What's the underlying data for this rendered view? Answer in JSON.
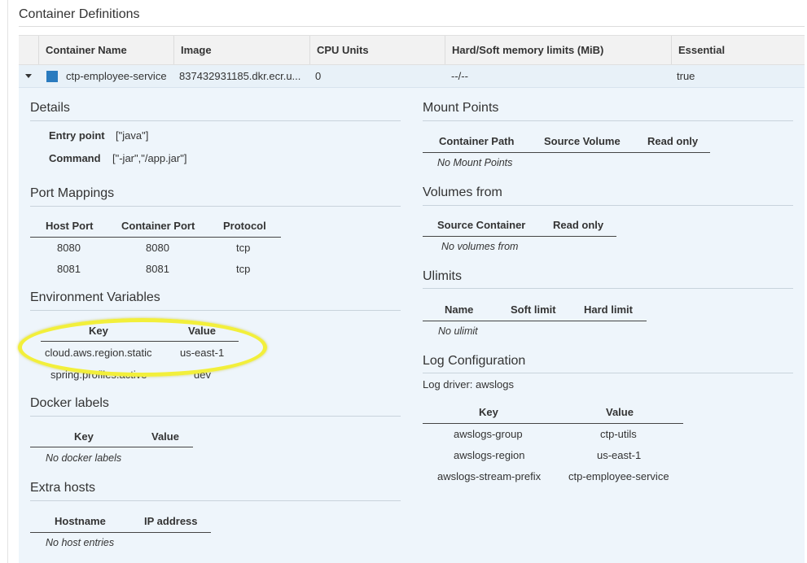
{
  "section_title": "Container Definitions",
  "table": {
    "headers": [
      "Container Name",
      "Image",
      "CPU Units",
      "Hard/Soft memory limits (MiB)",
      "Essential"
    ],
    "row": {
      "name": "ctp-employee-service",
      "image": "837432931185.dkr.ecr.u...",
      "cpu": "0",
      "memory": "--/--",
      "essential": "true"
    }
  },
  "details": {
    "title": "Details",
    "entry_point_label": "Entry point",
    "entry_point_value": "[\"java\"]",
    "command_label": "Command",
    "command_value": "[\"-jar\",\"/app.jar\"]"
  },
  "port_mappings": {
    "title": "Port Mappings",
    "headers": [
      "Host Port",
      "Container Port",
      "Protocol"
    ],
    "rows": [
      [
        "8080",
        "8080",
        "tcp"
      ],
      [
        "8081",
        "8081",
        "tcp"
      ]
    ]
  },
  "environment": {
    "title": "Environment Variables",
    "headers": [
      "Key",
      "Value"
    ],
    "rows": [
      [
        "cloud.aws.region.static",
        "us-east-1"
      ],
      [
        "spring.profiles.active",
        "dev"
      ]
    ]
  },
  "docker_labels": {
    "title": "Docker labels",
    "headers": [
      "Key",
      "Value"
    ],
    "empty": "No docker labels"
  },
  "extra_hosts": {
    "title": "Extra hosts",
    "headers": [
      "Hostname",
      "IP address"
    ],
    "empty": "No host entries"
  },
  "mount_points": {
    "title": "Mount Points",
    "headers": [
      "Container Path",
      "Source Volume",
      "Read only"
    ],
    "empty": "No Mount Points"
  },
  "volumes_from": {
    "title": "Volumes from",
    "headers": [
      "Source Container",
      "Read only"
    ],
    "empty": "No volumes from"
  },
  "ulimits": {
    "title": "Ulimits",
    "headers": [
      "Name",
      "Soft limit",
      "Hard limit"
    ],
    "empty": "No ulimit"
  },
  "log_configuration": {
    "title": "Log Configuration",
    "driver": "Log driver: awslogs",
    "headers": [
      "Key",
      "Value"
    ],
    "rows": [
      [
        "awslogs-group",
        "ctp-utils"
      ],
      [
        "awslogs-region",
        "us-east-1"
      ],
      [
        "awslogs-stream-prefix",
        "ctp-employee-service"
      ]
    ]
  },
  "colors": {
    "swatch": "#2a7bbf",
    "highlight": "#f2ef3b",
    "panel": "#eef5fb"
  }
}
